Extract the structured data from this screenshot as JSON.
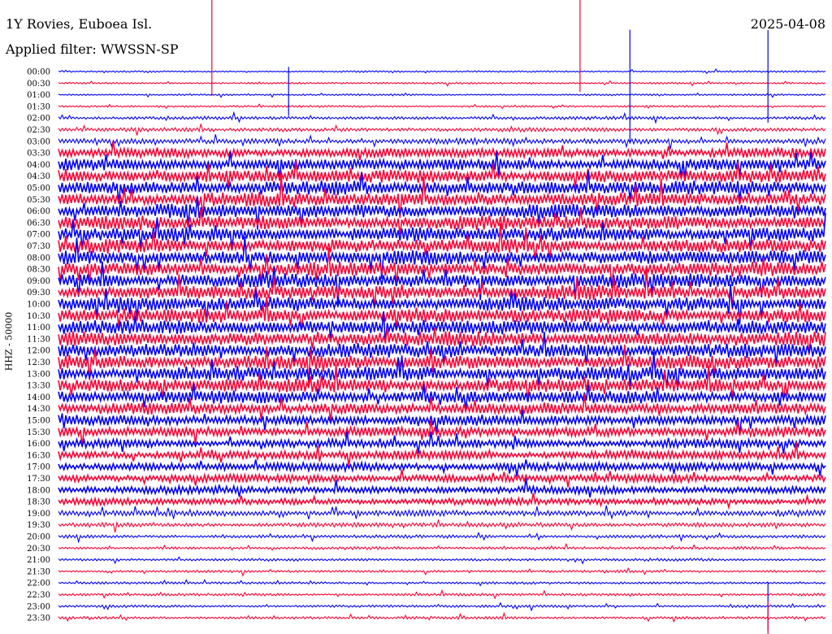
{
  "header": {
    "station": "1Y Rovies, Euboea Isl.",
    "filter": "Applied filter: WWSSN-SP",
    "date": "2025-04-08"
  },
  "chart_data": {
    "type": "line",
    "title": "1Y Rovies, Euboea Isl.",
    "ylabel": "HHZ - 50000",
    "row_labels": [
      "00:00",
      "00:30",
      "01:00",
      "01:30",
      "02:00",
      "02:30",
      "03:00",
      "03:30",
      "04:00",
      "04:30",
      "05:00",
      "05:30",
      "06:00",
      "06:30",
      "07:00",
      "07:30",
      "08:00",
      "08:30",
      "09:00",
      "09:30",
      "10:00",
      "10:30",
      "11:00",
      "11:30",
      "12:00",
      "12:30",
      "13:00",
      "13:30",
      "14:00",
      "14:30",
      "15:00",
      "15:30",
      "16:00",
      "16:30",
      "17:00",
      "17:30",
      "18:00",
      "18:30",
      "19:00",
      "19:30",
      "20:00",
      "20:30",
      "21:00",
      "21:30",
      "22:00",
      "22:30",
      "23:00",
      "23:30"
    ],
    "row_amplitude": [
      0.8,
      0.9,
      0.9,
      1.0,
      1.6,
      2.0,
      2.8,
      4.6,
      5.6,
      6.4,
      6.8,
      6.8,
      7.0,
      7.0,
      7.0,
      7.0,
      7.0,
      7.0,
      7.0,
      7.0,
      7.0,
      7.0,
      7.0,
      7.0,
      7.0,
      7.0,
      7.0,
      6.8,
      6.2,
      5.6,
      5.0,
      4.8,
      4.2,
      4.2,
      4.0,
      3.8,
      3.6,
      3.2,
      3.0,
      2.2,
      1.6,
      1.4,
      1.3,
      1.2,
      1.2,
      1.3,
      1.2,
      1.3
    ],
    "series_colors": [
      "#0000ff",
      "#ff0033"
    ],
    "grid": false
  }
}
